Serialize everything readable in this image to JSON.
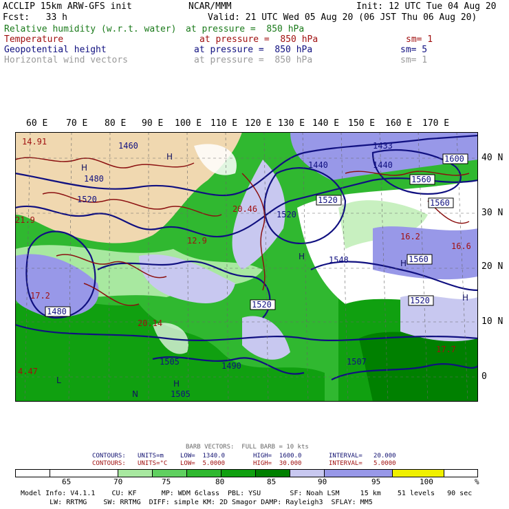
{
  "header": {
    "line1_left": "ACCLIP 15km ARW-GFS init",
    "line1_mid": "NCAR/MMM",
    "line1_right": "Init: 12 UTC Tue 04 Aug 20",
    "line2_left": "Fcst:   33 h",
    "line2_right": "Valid: 21 UTC Wed 05 Aug 20 (06 JST Thu 06 Aug 20)",
    "fields": [
      {
        "name": "Relative humidity (w.r.t. water)",
        "level": "at pressure =  850 hPa",
        "sm": ""
      },
      {
        "name": "Temperature",
        "level": "at pressure =  850 hPa",
        "sm": "sm= 1"
      },
      {
        "name": "Geopotential height",
        "level": "at pressure =  850 hPa",
        "sm": "sm= 5"
      },
      {
        "name": "Horizontal wind vectors",
        "level": "at pressure =  850 hPa",
        "sm": "sm= 1"
      }
    ]
  },
  "map": {
    "lon_labels": [
      "60 E",
      "70 E",
      "80 E",
      "90 E",
      "100 E",
      "110 E",
      "120 E",
      "130 E",
      "140 E",
      "150 E",
      "160 E",
      "170 E"
    ],
    "lat_labels": [
      "40 N",
      "30 N",
      "20 N",
      "10 N",
      "0"
    ],
    "height_contour_labels": [
      "1600",
      "1560",
      "1560",
      "1520",
      "1560",
      "1520",
      "1480",
      "1520",
      "1520",
      "1548",
      "1505",
      "1490",
      "1507",
      "1505",
      "1480",
      "1520",
      "1460",
      "1440",
      "1433",
      "1440"
    ],
    "temp_labels": [
      "14.91",
      "20.46",
      "20.14",
      "17.2",
      "16.6",
      "21.9",
      "16.2",
      "12.9",
      "4.47",
      "17.7"
    ],
    "colors": {
      "rh_lt65": "#ffffff",
      "rh_terrain": "#f0d8b0",
      "rh_70": "#a8e8a0",
      "rh_75": "#60d060",
      "rh_80": "#30b830",
      "rh_85": "#10a010",
      "rh_90": "#008000",
      "rh_95": "#c8c8f0",
      "rh_100": "#9898e8",
      "rh_max": "#f0f000",
      "height_contour": "#101080",
      "temp_contour": "#8b1010"
    }
  },
  "legend": {
    "barb_text": "BARB VECTORS:  FULL BARB = 10 kts",
    "contour1": {
      "label": "CONTOURS:",
      "units": "UNITS=m",
      "low": "LOW=  1340.0",
      "high": "HIGH=  1600.0",
      "interval": "INTERVAL=   20.000"
    },
    "contour2": {
      "label": "CONTOURS:",
      "units": "UNITS=°C",
      "low": "LOW=  5.0000",
      "high": "HIGH=  30.000",
      "interval": "INTERVAL=   5.0000"
    },
    "colorbar_labels": [
      "65",
      "70",
      "75",
      "80",
      "85",
      "90",
      "95",
      "100",
      "%"
    ],
    "colorbar_colors": [
      "#ffffff",
      "#ffffff",
      "#a8e8a0",
      "#60d060",
      "#30b830",
      "#10a010",
      "#008000",
      "#c8c8f0",
      "#9898e8",
      "#f0f000"
    ]
  },
  "footer": {
    "line1": "Model Info: V4.1.1    CU: KF      MP: WDM 6class  PBL: YSU       SF: Noah LSM     15 km    51 levels   90 sec",
    "line2": "       LW: RRTMG    SW: RRTMG  DIFF: simple KM: 2D Smagor DAMP: Rayleigh3  SFLAY: MM5"
  }
}
